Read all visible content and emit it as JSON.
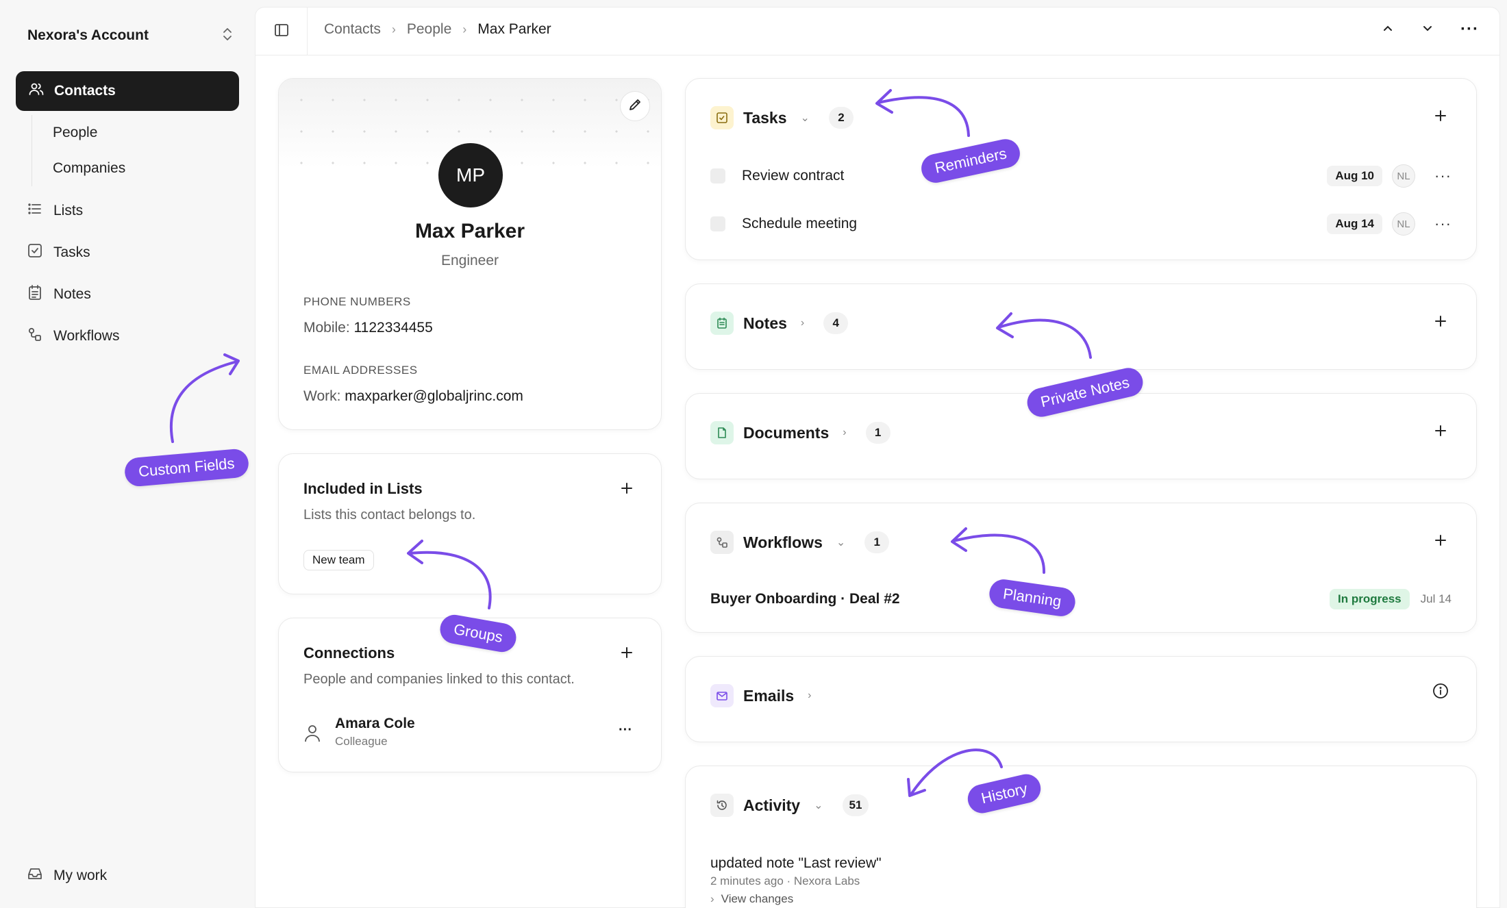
{
  "sidebar": {
    "account_name": "Nexora's Account",
    "nav_active": "Contacts",
    "sub_items": [
      "People",
      "Companies"
    ],
    "items": [
      "Lists",
      "Tasks",
      "Notes",
      "Workflows"
    ],
    "footer_item": "My work"
  },
  "breadcrumb": [
    "Contacts",
    "People",
    "Max Parker"
  ],
  "profile": {
    "initials": "MP",
    "name": "Max Parker",
    "role": "Engineer",
    "phone_label": "PHONE NUMBERS",
    "phone_type": "Mobile:",
    "phone_value": "1122334455",
    "email_label": "EMAIL ADDRESSES",
    "email_type": "Work:",
    "email_value": "maxparker@globaljrinc.com"
  },
  "lists_card": {
    "title": "Included in Lists",
    "subtitle": "Lists this contact belongs to.",
    "tag": "New team"
  },
  "connections_card": {
    "title": "Connections",
    "subtitle": "People and companies linked to this contact.",
    "person_name": "Amara Cole",
    "person_relation": "Colleague"
  },
  "tasks": {
    "title": "Tasks",
    "count": "2",
    "items": [
      {
        "label": "Review contract",
        "date": "Aug 10",
        "assignee": "NL"
      },
      {
        "label": "Schedule meeting",
        "date": "Aug 14",
        "assignee": "NL"
      }
    ]
  },
  "notes": {
    "title": "Notes",
    "count": "4"
  },
  "documents": {
    "title": "Documents",
    "count": "1"
  },
  "workflows": {
    "title": "Workflows",
    "count": "1",
    "item_label": "Buyer Onboarding · Deal #2",
    "item_status": "In progress",
    "item_date": "Jul 14"
  },
  "emails": {
    "title": "Emails"
  },
  "activity": {
    "title": "Activity",
    "count": "51",
    "entry_title": "updated note \"Last review\"",
    "entry_meta": "2 minutes ago · Nexora Labs",
    "entry_link": "View changes"
  },
  "annotations": {
    "reminders": "Reminders",
    "private_notes": "Private Notes",
    "custom_fields": "Custom Fields",
    "groups": "Groups",
    "planning": "Planning",
    "history": "History"
  },
  "colors": {
    "accent": "#7a4ce8",
    "active_nav": "#1c1c1c",
    "status_green_bg": "#dff5e6",
    "status_green_text": "#1f7a3f"
  }
}
